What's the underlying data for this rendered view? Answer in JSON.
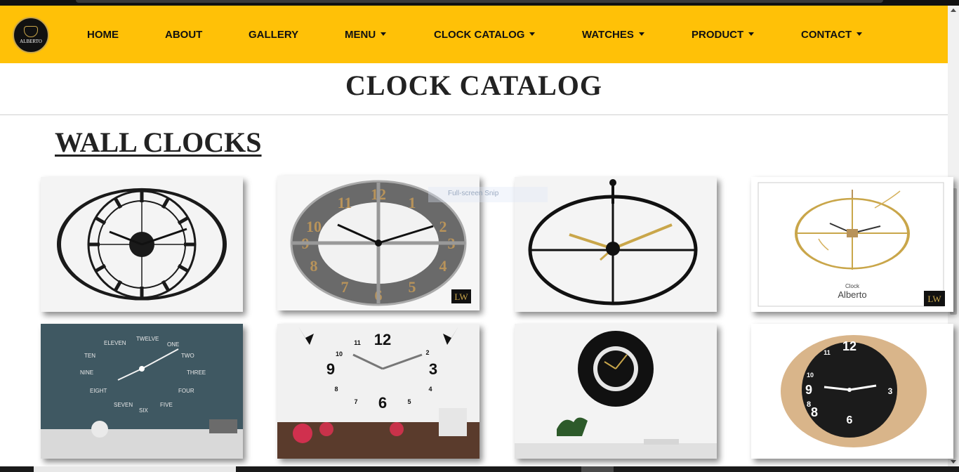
{
  "logo": {
    "text": "ALBERTO"
  },
  "nav": {
    "home": "HOME",
    "about": "ABOUT",
    "gallery": "GALLERY",
    "menu": "MENU",
    "clock_catalog": "CLOCK CATALOG",
    "watches": "WATCHES",
    "product": "PRODUCT",
    "contact": "CONTACT"
  },
  "page": {
    "title": "CLOCK CATALOG",
    "section": "WALL CLOCKS"
  },
  "overlay": {
    "snip": "Full-screen Snip"
  },
  "products": {
    "p4_brand": "Alberto",
    "p4_small": "Clock",
    "badge": "LW"
  },
  "colors": {
    "navbar": "#FFC107",
    "text": "#222222"
  }
}
